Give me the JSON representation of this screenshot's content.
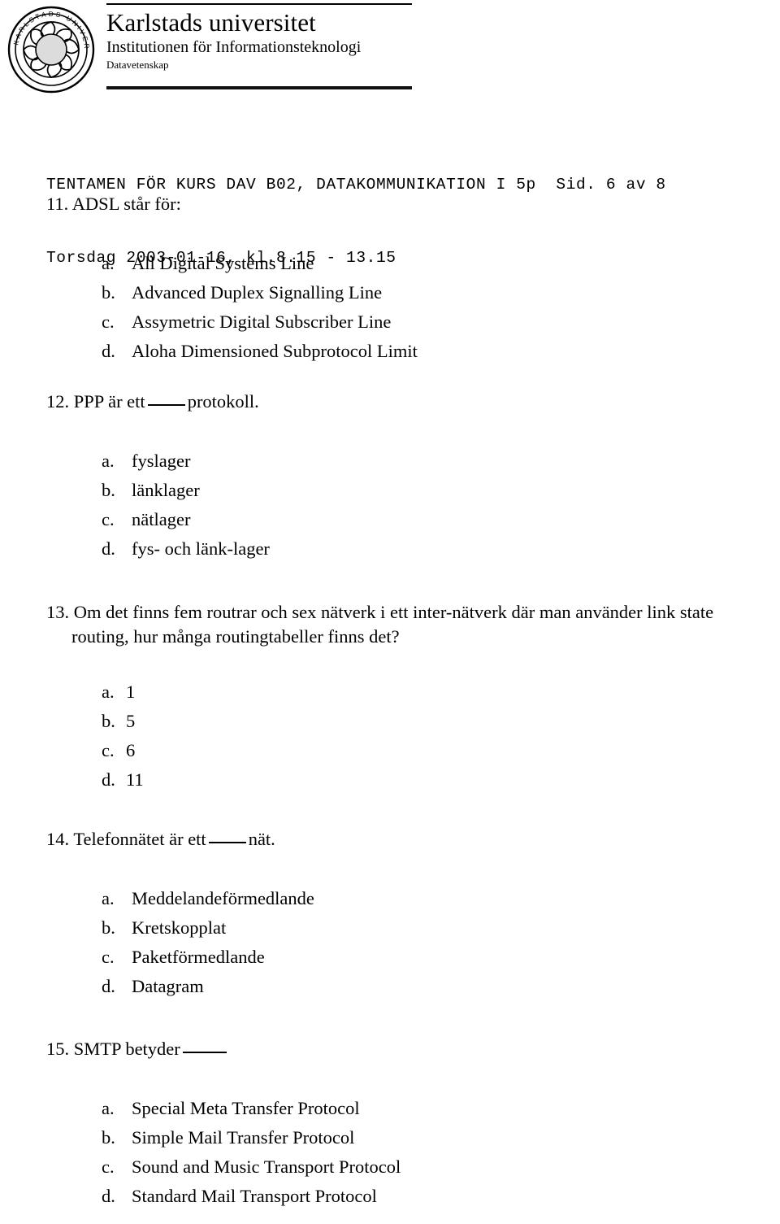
{
  "letterhead": {
    "logo_alt": "Karlstads universitet seal",
    "seal_text": "KARLSTADS UNIVERSITET",
    "title": "Karlstads universitet",
    "department": "Institutionen för Informationsteknologi",
    "subject": "Datavetenskap"
  },
  "exam_header": {
    "line1_left": "TENTAMEN FÖR KURS DAV B02, DATAKOMMUNIKATION I 5p",
    "line1_right": "Sid. 6 av 8",
    "line2": "Torsdag 2003-01-16, kl.8.15 - 13.15"
  },
  "questions": [
    {
      "number": "11.",
      "text": "ADSL står för:",
      "choices": [
        {
          "label": "a.",
          "text": "All Digital Systems Line"
        },
        {
          "label": "b.",
          "text": "Advanced Duplex Signalling Line"
        },
        {
          "label": "c.",
          "text": "Assymetric Digital Subscriber Line"
        },
        {
          "label": "d.",
          "text": "Aloha Dimensioned Subprotocol Limit"
        }
      ]
    },
    {
      "number": "12.",
      "text_before_blank": "PPP är ett",
      "text_after_blank": "protokoll.",
      "choices": [
        {
          "label": "a.",
          "text": "fyslager"
        },
        {
          "label": "b.",
          "text": "länklager"
        },
        {
          "label": "c.",
          "text": "nätlager"
        },
        {
          "label": "d.",
          "text": "fys- och länk-lager"
        }
      ]
    },
    {
      "number": "13.",
      "text": "Om det finns fem routrar och sex nätverk i ett inter-nätverk där man använder link state routing, hur många routingtabeller finns det?",
      "choices": [
        {
          "label": "a.",
          "text": "1"
        },
        {
          "label": "b.",
          "text": "5"
        },
        {
          "label": "c.",
          "text": "6"
        },
        {
          "label": "d.",
          "text": "11"
        }
      ]
    },
    {
      "number": "14.",
      "text_before_blank": "Telefonnätet är ett",
      "text_after_blank": "nät.",
      "choices": [
        {
          "label": "a.",
          "text": "Meddelandeförmedlande"
        },
        {
          "label": "b.",
          "text": "Kretskopplat"
        },
        {
          "label": "c.",
          "text": "Paketförmedlande"
        },
        {
          "label": "d.",
          "text": "Datagram"
        }
      ]
    },
    {
      "number": "15.",
      "text_before_blank": "SMTP betyder",
      "text_after_blank": "",
      "choices": [
        {
          "label": "a.",
          "text": "Special Meta Transfer Protocol"
        },
        {
          "label": "b.",
          "text": "Simple Mail Transfer Protocol"
        },
        {
          "label": "c.",
          "text": "Sound and Music Transport Protocol"
        },
        {
          "label": "d.",
          "text": "Standard Mail Transport Protocol"
        }
      ]
    }
  ]
}
